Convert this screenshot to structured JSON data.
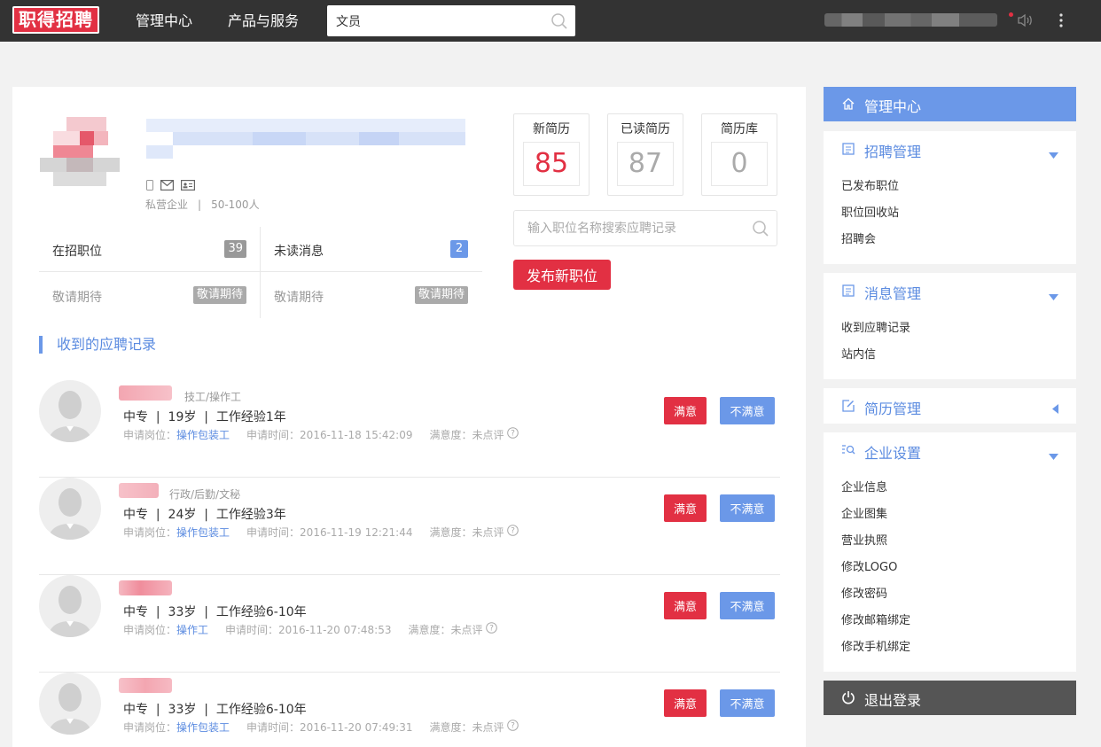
{
  "header": {
    "logo_text": "职得招聘",
    "nav": [
      "管理中心",
      "产品与服务"
    ],
    "search_value": "文员"
  },
  "company": {
    "type": "私营企业",
    "separator": "|",
    "size": "50-100人"
  },
  "stats": {
    "open_jobs_label": "在招职位",
    "open_jobs_count": "39",
    "unread_label": "未读消息",
    "unread_count": "2",
    "coming_label_1": "敬请期待",
    "coming_badge_1": "敬请期待",
    "coming_label_2": "敬请期待",
    "coming_badge_2": "敬请期待"
  },
  "resumes": [
    {
      "title": "新简历",
      "value": "85"
    },
    {
      "title": "已读简历",
      "value": "87"
    },
    {
      "title": "简历库",
      "value": "0"
    }
  ],
  "job_search": {
    "placeholder": "输入职位名称搜索应聘记录"
  },
  "publish_label": "发布新职位",
  "section_title": "收到的应聘记录",
  "applications": [
    {
      "category": "技工/操作工",
      "edu": "中专",
      "age": "19岁",
      "exp": "工作经验1年",
      "position_label": "申请岗位：",
      "position": "操作包装工",
      "time_label": "申请时间：",
      "time": "2016-11-18 15:42:09",
      "rating_label": "满意度：",
      "rating": "未点评",
      "sat": "满意",
      "unsat": "不满意"
    },
    {
      "category": "行政/后勤/文秘",
      "edu": "中专",
      "age": "24岁",
      "exp": "工作经验3年",
      "position_label": "申请岗位：",
      "position": "操作包装工",
      "time_label": "申请时间：",
      "time": "2016-11-19 12:21:44",
      "rating_label": "满意度：",
      "rating": "未点评",
      "sat": "满意",
      "unsat": "不满意"
    },
    {
      "category": "",
      "edu": "中专",
      "age": "33岁",
      "exp": "工作经验6-10年",
      "position_label": "申请岗位：",
      "position": "操作工",
      "time_label": "申请时间：",
      "time": "2016-11-20 07:48:53",
      "rating_label": "满意度：",
      "rating": "未点评",
      "sat": "满意",
      "unsat": "不满意"
    },
    {
      "category": "",
      "edu": "中专",
      "age": "33岁",
      "exp": "工作经验6-10年",
      "position_label": "申请岗位：",
      "position": "操作包装工",
      "time_label": "申请时间：",
      "time": "2016-11-20 07:49:31",
      "rating_label": "满意度：",
      "rating": "未点评",
      "sat": "满意",
      "unsat": "不满意"
    }
  ],
  "sidebar": {
    "top_label": "管理中心",
    "recruit": {
      "label": "招聘管理",
      "items": [
        "已发布职位",
        "职位回收站",
        "招聘会"
      ]
    },
    "message": {
      "label": "消息管理",
      "items": [
        "收到应聘记录",
        "站内信"
      ]
    },
    "resume": {
      "label": "简历管理"
    },
    "settings": {
      "label": "企业设置",
      "items": [
        "企业信息",
        "企业图集",
        "营业执照",
        "修改LOGO",
        "修改密码",
        "修改邮箱绑定",
        "修改手机绑定"
      ]
    },
    "logout_label": "退出登录"
  },
  "colors": {
    "brand_red": "#e23043",
    "accent_blue": "#6b98e8",
    "topbar": "#333333"
  }
}
